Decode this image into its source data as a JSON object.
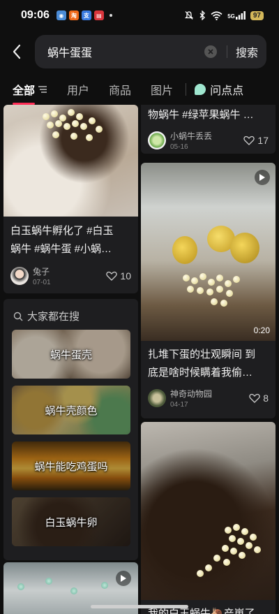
{
  "status_bar": {
    "time": "09:06",
    "network_label": "5G",
    "battery": "97",
    "app_icons": [
      {
        "name": "finder-app-icon",
        "color": "#4a8bd6"
      },
      {
        "name": "taobao-app-icon",
        "label": "淘",
        "color": "#f06a1b"
      },
      {
        "name": "alipay-app-icon",
        "color": "#3a7be0"
      },
      {
        "name": "news-app-icon",
        "color": "#d9353c"
      }
    ]
  },
  "search": {
    "query": "蜗牛蛋蛋",
    "submit_label": "搜索"
  },
  "tabs": [
    {
      "label": "全部",
      "active": true
    },
    {
      "label": "用户",
      "active": false
    },
    {
      "label": "商品",
      "active": false
    },
    {
      "label": "图片",
      "active": false
    }
  ],
  "ask_label": "问点点",
  "accent_color": "#fe2c55",
  "feed_left": [
    {
      "caption_line1": "白玉蜗牛孵化了 #白玉",
      "caption_line2": "蜗牛 #蜗牛蛋 #小蜗…",
      "author": "兔子",
      "date": "07-01",
      "likes": "10"
    },
    {
      "has_video": true
    }
  ],
  "feed_right": [
    {
      "caption_line1": "物蜗牛 #绿苹果蜗牛 …",
      "author": "小蜗牛丢丢",
      "date": "05-16",
      "likes": "17"
    },
    {
      "duration": "0:20",
      "caption_line1": "扎堆下蛋的壮观瞬间 到",
      "caption_line2": "底是啥时候瞒着我偷…",
      "author": "神奇动物园",
      "date": "04-17",
      "likes": "8"
    },
    {
      "caption_line1": "我的白玉蜗牛🐌产崽了"
    }
  ],
  "trending": {
    "title": "大家都在搜",
    "items": [
      {
        "label": "蜗牛蛋壳"
      },
      {
        "label": "蜗牛壳颜色"
      },
      {
        "label": "蜗牛能吃鸡蛋吗"
      },
      {
        "label": "白玉蜗牛卵"
      }
    ]
  }
}
